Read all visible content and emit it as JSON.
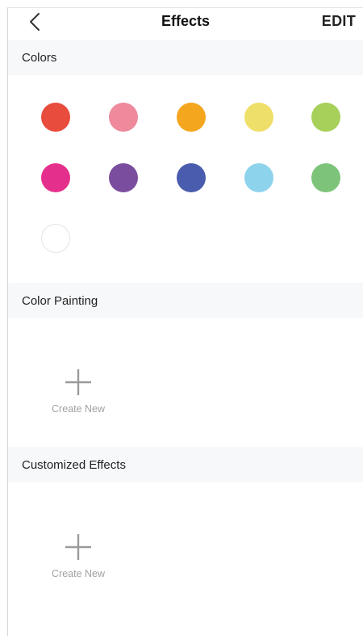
{
  "nav": {
    "back_icon": "chevron-left-icon",
    "title": "Effects",
    "edit_label": "EDIT"
  },
  "colors": {
    "header": "Colors",
    "swatches": [
      "#e84c3d",
      "#ee8a9c",
      "#f3a61e",
      "#eedf6a",
      "#a6d05a",
      "#e52f8c",
      "#7a4d9e",
      "#4a5cae",
      "#8dd3ec",
      "#7dc47a",
      "#ffffff"
    ]
  },
  "color_painting": {
    "header": "Color Painting",
    "create_icon": "plus-icon",
    "create_label": "Create New"
  },
  "customized_effects": {
    "header": "Customized Effects",
    "create_icon": "plus-icon",
    "create_label": "Create New"
  }
}
